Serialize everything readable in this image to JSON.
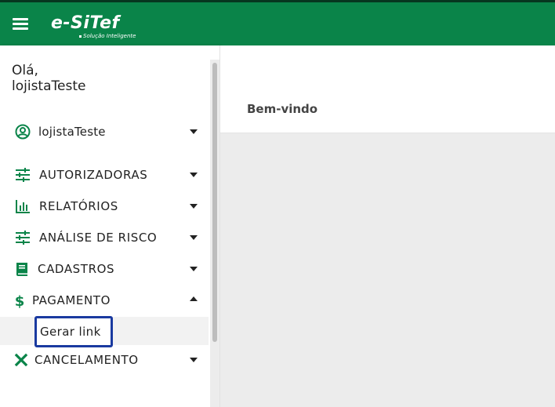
{
  "header": {
    "brand": "e-SiTef",
    "tagline": "Solução Inteligente",
    "menu_icon": "hamburger-menu-icon",
    "background_color": "#0a8449"
  },
  "sidebar": {
    "greeting_line1": "Olá,",
    "greeting_line2": "lojistaTeste",
    "user_item": {
      "label": "lojistaTeste",
      "icon": "user-circle-icon"
    },
    "items": [
      {
        "label": "AUTORIZADORAS",
        "icon": "sliders-icon",
        "expanded": false
      },
      {
        "label": "RELATÓRIOS",
        "icon": "bar-chart-icon",
        "expanded": false
      },
      {
        "label": "ANÁLISE DE RISCO",
        "icon": "sliders-icon",
        "expanded": false
      },
      {
        "label": "CADASTROS",
        "icon": "book-icon",
        "expanded": false
      },
      {
        "label": "PAGAMENTO",
        "icon": "dollar-icon",
        "expanded": true
      },
      {
        "label": "CANCELAMENTO",
        "icon": "close-x-icon",
        "expanded": false
      }
    ],
    "pagamento_subitems": [
      {
        "label": "Gerar link",
        "focused": true
      }
    ]
  },
  "main": {
    "title": "Bem-vindo"
  },
  "colors": {
    "brand_green": "#0a8449",
    "focus_outline": "#1a3aa0",
    "icon_color": "#0a8449"
  }
}
